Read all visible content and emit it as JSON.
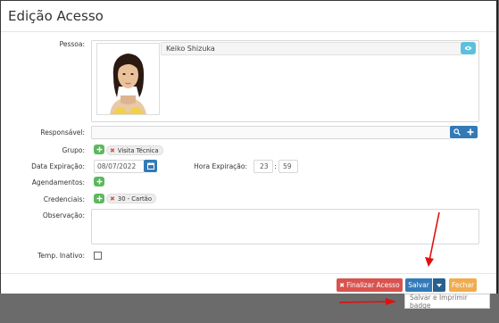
{
  "page": {
    "title": "Edição Acesso"
  },
  "form": {
    "pessoa": {
      "label": "Pessoa:",
      "value": "Keiko Shizuka"
    },
    "responsavel": {
      "label": "Responsável:",
      "value": ""
    },
    "grupo": {
      "label": "Grupo:",
      "tags": [
        "Visita Técnica"
      ]
    },
    "data_expiracao": {
      "label": "Data Expiração:",
      "value": "08/07/2022"
    },
    "hora_expiracao": {
      "label": "Hora Expiração:",
      "hour": "23",
      "separator": ":",
      "minute": "59"
    },
    "agendamentos": {
      "label": "Agendamentos:"
    },
    "credenciais": {
      "label": "Credenciais:",
      "tags": [
        "30 - Cartão"
      ]
    },
    "observacao": {
      "label": "Observação:",
      "value": ""
    },
    "temp_inativo": {
      "label": "Temp. Inativo:",
      "checked": false
    }
  },
  "footer": {
    "finalizar_label": "Finalizar Acesso",
    "salvar_label": "Salvar",
    "fechar_label": "Fechar",
    "dropdown_items": [
      "Salvar e Imprimir badge"
    ]
  },
  "colors": {
    "primary": "#337ab7",
    "success": "#5cb85c",
    "danger": "#d9534f",
    "warning": "#f0ad4e",
    "info": "#5bc0de",
    "annotation": "#e01010"
  },
  "icons": [
    "eye-icon",
    "search-icon",
    "plus-icon",
    "calendar-icon",
    "caret-down-icon",
    "close-icon"
  ]
}
